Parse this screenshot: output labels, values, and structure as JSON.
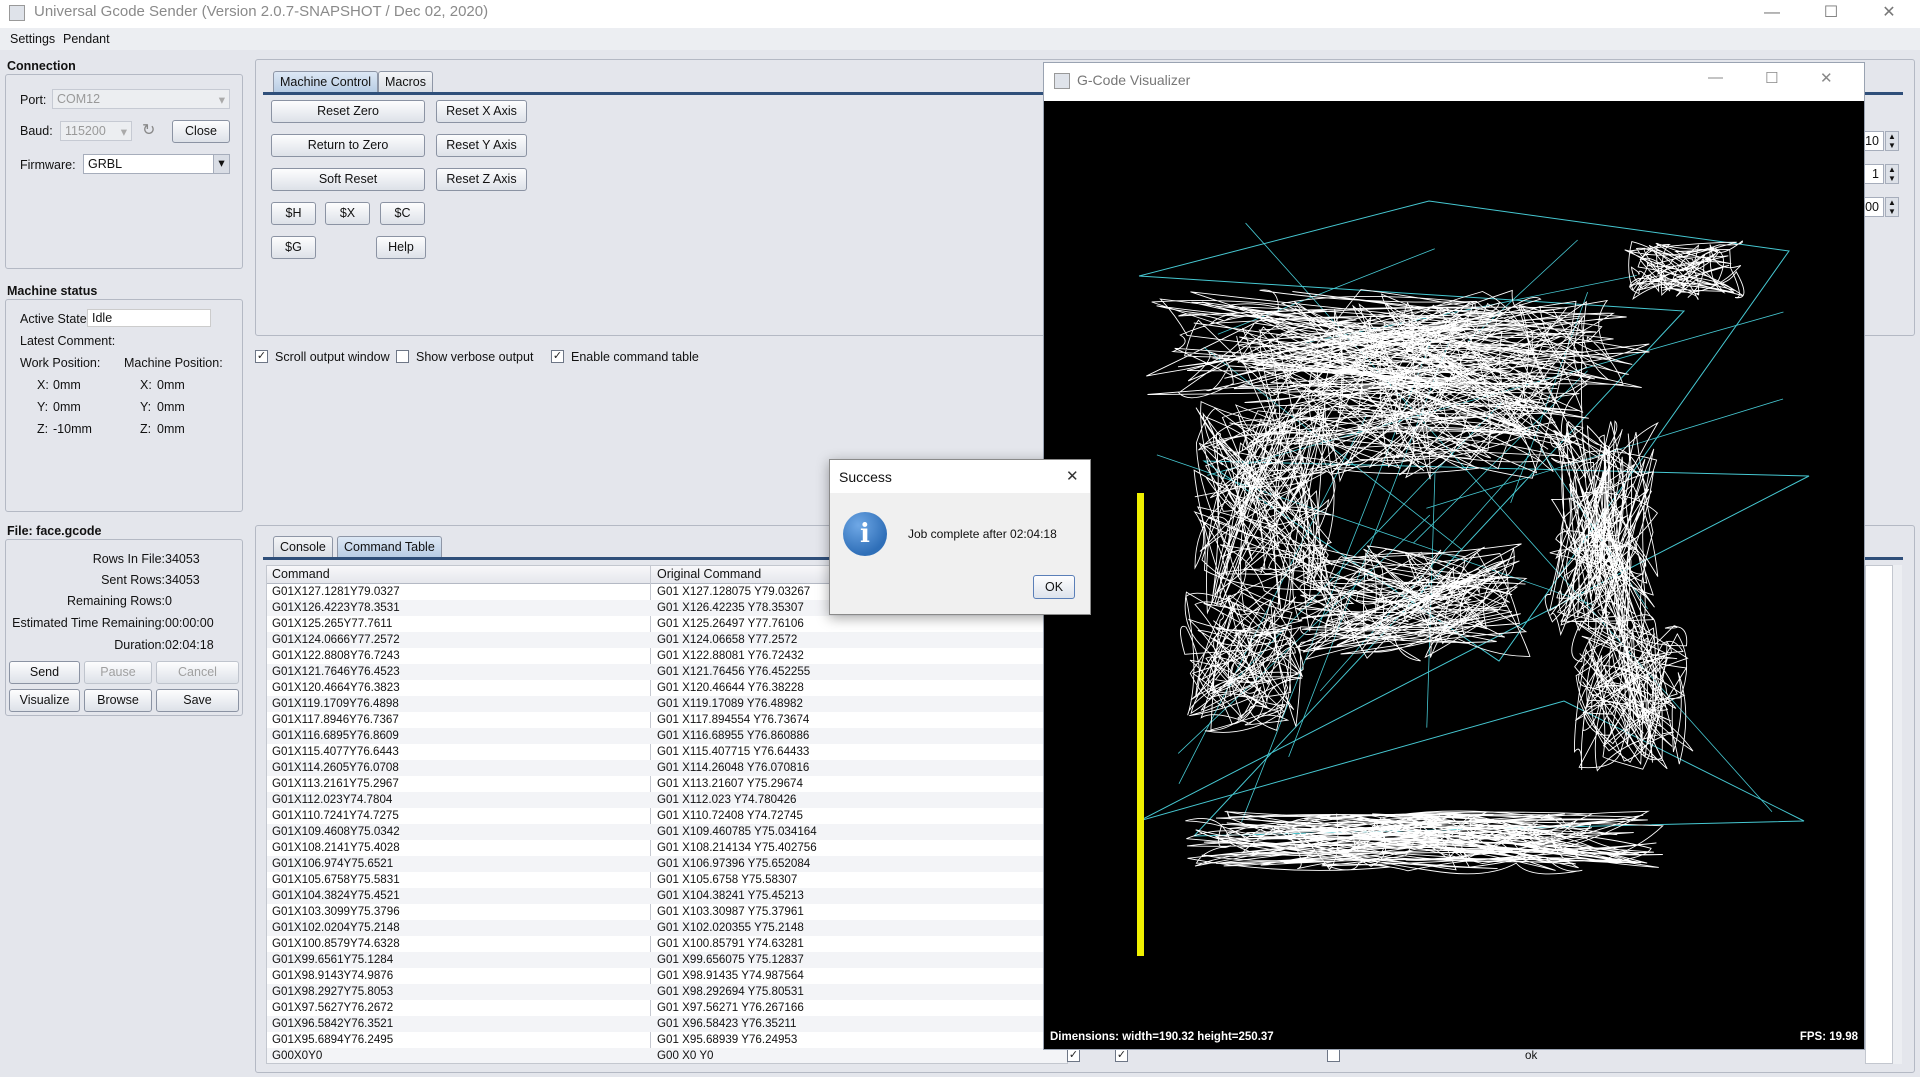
{
  "window": {
    "title": "Universal Gcode Sender (Version 2.0.7-SNAPSHOT / Dec 02, 2020)",
    "controls": {
      "minimize": "—",
      "maximize": "☐",
      "close": "✕"
    }
  },
  "menu": {
    "items": [
      "Settings",
      "Pendant"
    ]
  },
  "connection": {
    "title": "Connection",
    "port_label": "Port:",
    "port_value": "COM12",
    "baud_label": "Baud:",
    "baud_value": "115200",
    "refresh_icon": "↻",
    "close_button": "Close",
    "firmware_label": "Firmware:",
    "firmware_value": "GRBL"
  },
  "machine_status": {
    "title": "Machine status",
    "active_state_label": "Active State:",
    "active_state_value": "Idle",
    "latest_comment_label": "Latest Comment:",
    "work_position_label": "Work Position:",
    "machine_position_label": "Machine Position:",
    "work": {
      "x_label": "X:",
      "x": "0mm",
      "y_label": "Y:",
      "y": "0mm",
      "z_label": "Z:",
      "z": "-10mm"
    },
    "machine": {
      "x_label": "X:",
      "x": "0mm",
      "y_label": "Y:",
      "y": "0mm",
      "z_label": "Z:",
      "z": "0mm"
    }
  },
  "file": {
    "title": "File: face.gcode",
    "rows_in_file_label": "Rows In File:",
    "rows_in_file": "34053",
    "sent_rows_label": "Sent Rows:",
    "sent_rows": "34053",
    "remaining_rows_label": "Remaining Rows:",
    "remaining_rows": "0",
    "est_time_label": "Estimated Time Remaining:",
    "est_time": "00:00:00",
    "duration_label": "Duration:",
    "duration": "02:04:18",
    "buttons": {
      "send": "Send",
      "pause": "Pause",
      "cancel": "Cancel",
      "visualize": "Visualize",
      "browse": "Browse",
      "save": "Save"
    }
  },
  "control_tabs": {
    "machine_control": "Machine Control",
    "macros": "Macros"
  },
  "machine_control": {
    "reset_zero": "Reset Zero",
    "return_to_zero": "Return to Zero",
    "soft_reset": "Soft Reset",
    "reset_x": "Reset X Axis",
    "reset_y": "Reset Y Axis",
    "reset_z": "Reset Z Axis",
    "cmd_h": "$H",
    "cmd_x": "$X",
    "cmd_c": "$C",
    "cmd_g": "$G",
    "help": "Help"
  },
  "options": {
    "scroll_output": "Scroll output window",
    "scroll_output_checked": true,
    "verbose_output": "Show verbose output",
    "verbose_output_checked": false,
    "enable_command_table": "Enable command table",
    "enable_command_table_checked": true
  },
  "output_tabs": {
    "console": "Console",
    "command_table": "Command Table"
  },
  "command_table": {
    "headers": [
      "Command",
      "Original Command"
    ],
    "rows": [
      [
        "G01X127.1281Y79.0327",
        "G01 X127.128075 Y79.03267"
      ],
      [
        "G01X126.4223Y78.3531",
        "G01 X126.42235 Y78.35307"
      ],
      [
        "G01X125.265Y77.7611",
        "G01 X125.26497 Y77.76106"
      ],
      [
        "G01X124.0666Y77.2572",
        "G01 X124.06658 Y77.2572"
      ],
      [
        "G01X122.8808Y76.7243",
        "G01 X122.88081 Y76.72432"
      ],
      [
        "G01X121.7646Y76.4523",
        "G01 X121.76456 Y76.452255"
      ],
      [
        "G01X120.4664Y76.3823",
        "G01 X120.46644 Y76.38228"
      ],
      [
        "G01X119.1709Y76.4898",
        "G01 X119.17089 Y76.48982"
      ],
      [
        "G01X117.8946Y76.7367",
        "G01 X117.894554 Y76.73674"
      ],
      [
        "G01X116.6895Y76.8609",
        "G01 X116.68955 Y76.860886"
      ],
      [
        "G01X115.4077Y76.6443",
        "G01 X115.407715 Y76.64433"
      ],
      [
        "G01X114.2605Y76.0708",
        "G01 X114.26048 Y76.070816"
      ],
      [
        "G01X113.2161Y75.2967",
        "G01 X113.21607 Y75.29674"
      ],
      [
        "G01X112.023Y74.7804",
        "G01 X112.023 Y74.780426"
      ],
      [
        "G01X110.7241Y74.7275",
        "G01 X110.72408 Y74.72745"
      ],
      [
        "G01X109.4608Y75.0342",
        "G01 X109.460785 Y75.034164"
      ],
      [
        "G01X108.2141Y75.4028",
        "G01 X108.214134 Y75.402756"
      ],
      [
        "G01X106.974Y75.6521",
        "G01 X106.97396 Y75.652084"
      ],
      [
        "G01X105.6758Y75.5831",
        "G01 X105.6758 Y75.58307"
      ],
      [
        "G01X104.3824Y75.4521",
        "G01 X104.38241 Y75.45213"
      ],
      [
        "G01X103.3099Y75.3796",
        "G01 X103.30987 Y75.37961"
      ],
      [
        "G01X102.0204Y75.2148",
        "G01 X102.020355 Y75.2148"
      ],
      [
        "G01X100.8579Y74.6328",
        "G01 X100.85791 Y74.63281"
      ],
      [
        "G01X99.6561Y75.1284",
        "G01 X99.656075 Y75.12837"
      ],
      [
        "G01X98.9143Y74.9876",
        "G01 X98.91435 Y74.987564"
      ],
      [
        "G01X98.2927Y75.8053",
        "G01 X98.292694 Y75.80531"
      ],
      [
        "G01X97.5627Y76.2672",
        "G01 X97.56271 Y76.267166"
      ],
      [
        "G01X96.5842Y76.3521",
        "G01 X96.58423 Y76.35211"
      ],
      [
        "G01X95.6894Y76.2495",
        "G01 X95.68939 Y76.24953"
      ],
      [
        "G00X0Y0",
        "G00 X0 Y0"
      ]
    ],
    "last_row_response": "ok"
  },
  "jog_spinners": [
    "10",
    "1",
    "00"
  ],
  "visualizer": {
    "title": "G-Code Visualizer",
    "dimensions": "Dimensions: width=190.32 height=250.37",
    "fps": "FPS: 19.98"
  },
  "dialog": {
    "title": "Success",
    "message": "Job complete after 02:04:18",
    "ok": "OK",
    "close": "✕",
    "info_icon": "i"
  },
  "colors": {
    "background": "#e4e6ec",
    "tab_selected": "#b6cbe3",
    "visualizer_bg": "#000000",
    "toolpath": "#ffffff",
    "rapid_moves": "#46c8d2",
    "z_indicator": "#f0f000",
    "info_icon": "#2f6fb8"
  }
}
